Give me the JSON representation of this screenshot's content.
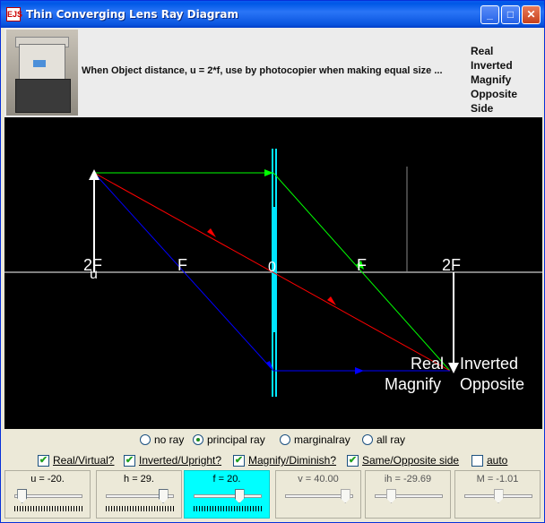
{
  "window": {
    "title": "Thin Converging Lens Ray Diagram",
    "app_icon": "EJS",
    "minimize_icon": "minimize-icon",
    "maximize_icon": "maximize-icon",
    "close_icon": "close-icon"
  },
  "header": {
    "description": "When Object distance, u = 2*f, use by photocopier when making equal size ...",
    "properties": [
      "Real",
      "Inverted",
      "Magnify",
      "Opposite Side"
    ]
  },
  "diagram": {
    "point_labels": [
      "2F",
      "F",
      "0",
      "F",
      "2F"
    ],
    "object_label": "u",
    "image_labels": {
      "line1a": "Real",
      "line1b": "Inverted",
      "line2a": "Magnify",
      "line2b": "Opposite"
    }
  },
  "ray_options": {
    "none": "no ray",
    "principal": "principal ray",
    "marginal": "marginalray",
    "all": "all ray",
    "selected": "principal ray"
  },
  "checkboxes": [
    {
      "label": "Real/Virtual?",
      "checked": true
    },
    {
      "label": "Inverted/Upright?",
      "checked": true
    },
    {
      "label": "Magnify/Diminish?",
      "checked": true
    },
    {
      "label": "Same/Opposite side",
      "checked": true
    },
    {
      "label": "auto",
      "checked": false
    }
  ],
  "sliders": [
    {
      "label": "u  = -20.",
      "value_fraction": 0.05,
      "enabled": true
    },
    {
      "label": "h = 29.",
      "value_fraction": 0.9,
      "enabled": true
    },
    {
      "label": "f = 20.",
      "value_fraction": 0.7,
      "enabled": true
    },
    {
      "label": "v = 40.00",
      "value_fraction": 0.95,
      "enabled": false
    },
    {
      "label": "ih = -29.69",
      "value_fraction": 0.2,
      "enabled": false
    },
    {
      "label": "M = -1.01",
      "value_fraction": 0.5,
      "enabled": false
    }
  ],
  "colors": {
    "titlebar": "#0a55df",
    "canvas_bg": "#000000",
    "lens": "#00e5ff",
    "ray_parallel": "#00ff00",
    "ray_center": "#ff0000",
    "ray_focal": "#0000ff",
    "axis": "#ffffff",
    "highlight_slider": "#00ffff"
  }
}
